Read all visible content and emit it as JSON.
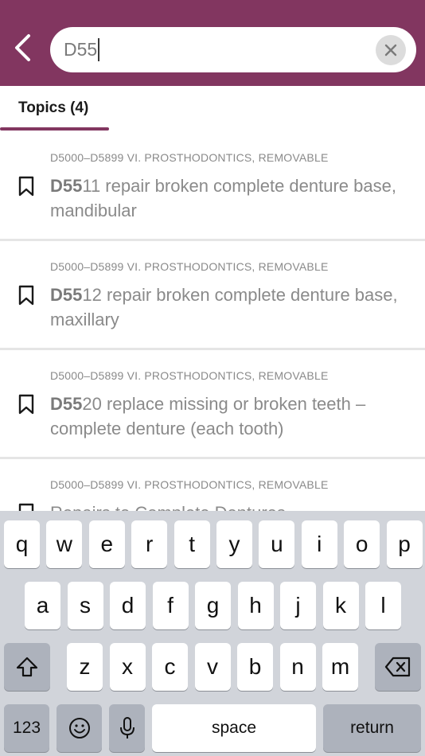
{
  "header": {
    "back_icon": "chevron-left-icon",
    "search": {
      "value": "D55",
      "clear_icon": "close-icon"
    },
    "background_color": "#823660"
  },
  "tabs": [
    {
      "label": "Topics (4)",
      "active": true
    }
  ],
  "results": [
    {
      "category": "D5000–D5899 VI. PROSTHODONTICS, REMOVABLE",
      "match": "D55",
      "rest": "11 repair broken complete denture base, mandibular"
    },
    {
      "category": "D5000–D5899 VI. PROSTHODONTICS, REMOVABLE",
      "match": "D55",
      "rest": "12 repair broken complete denture base, maxillary"
    },
    {
      "category": "D5000–D5899 VI. PROSTHODONTICS, REMOVABLE",
      "match": "D55",
      "rest": "20 replace missing or broken teeth – complete denture (each tooth)"
    },
    {
      "category": "D5000–D5899 VI. PROSTHODONTICS, REMOVABLE",
      "match": "",
      "rest": "Repairs to Complete Dentures"
    }
  ],
  "keyboard": {
    "row1": [
      "q",
      "w",
      "e",
      "r",
      "t",
      "y",
      "u",
      "i",
      "o",
      "p"
    ],
    "row2": [
      "a",
      "s",
      "d",
      "f",
      "g",
      "h",
      "j",
      "k",
      "l"
    ],
    "row3": [
      "z",
      "x",
      "c",
      "v",
      "b",
      "n",
      "m"
    ],
    "shift_icon": "shift-icon",
    "delete_icon": "backspace-icon",
    "numbers_label": "123",
    "emoji_icon": "emoji-icon",
    "mic_icon": "microphone-icon",
    "space_label": "space",
    "return_label": "return"
  }
}
